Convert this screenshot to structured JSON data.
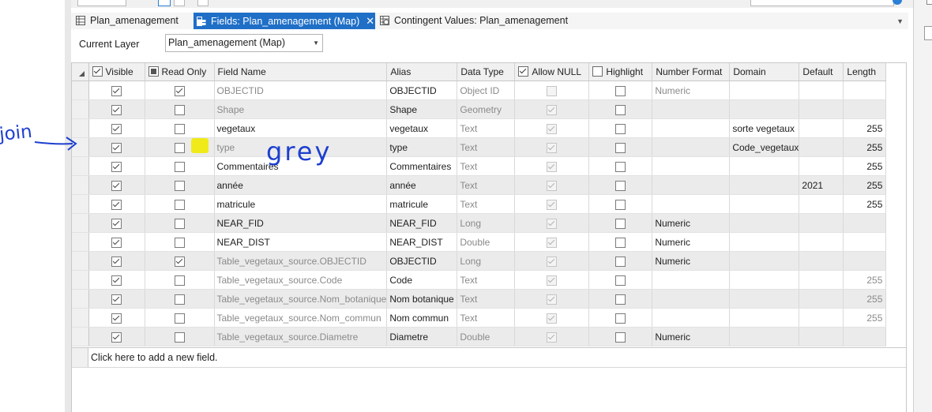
{
  "tabs": [
    {
      "label": "Plan_amenagement",
      "icon": "table-icon",
      "active": false
    },
    {
      "label": "Fields:  Plan_amenagement (Map)",
      "icon": "fields-icon",
      "active": true
    },
    {
      "label": "Contingent Values: Plan_amenagement",
      "icon": "contingent-values-icon",
      "active": false
    }
  ],
  "close_glyph": "✕",
  "current_layer": {
    "label": "Current Layer",
    "value": "Plan_amenagement (Map)"
  },
  "columns": {
    "visible": "Visible",
    "read_only": "Read Only",
    "field_name": "Field Name",
    "alias": "Alias",
    "data_type": "Data Type",
    "allow_null": "Allow NULL",
    "highlight": "Highlight",
    "number_format": "Number Format",
    "domain": "Domain",
    "default": "Default",
    "length": "Length"
  },
  "rows": [
    {
      "visible": true,
      "read_only": true,
      "field_name": "OBJECTID",
      "alias": "OBJECTID",
      "data_type": "Object ID",
      "allow_null": false,
      "null_enabled": false,
      "highlight": false,
      "number_format": "Numeric",
      "domain": "",
      "default": "",
      "length": "",
      "name_gray": true,
      "format_gray": true,
      "length_gray": false
    },
    {
      "visible": true,
      "read_only": false,
      "field_name": "Shape",
      "alias": "Shape",
      "data_type": "Geometry",
      "allow_null": true,
      "null_enabled": false,
      "highlight": false,
      "number_format": "",
      "domain": "",
      "default": "",
      "length": "",
      "name_gray": true,
      "format_gray": false,
      "length_gray": false
    },
    {
      "visible": true,
      "read_only": false,
      "field_name": "vegetaux",
      "alias": "vegetaux",
      "data_type": "Text",
      "allow_null": true,
      "null_enabled": false,
      "highlight": false,
      "number_format": "",
      "domain": "sorte vegetaux",
      "default": "",
      "length": "255",
      "name_gray": false,
      "format_gray": false,
      "length_gray": false
    },
    {
      "visible": true,
      "read_only": false,
      "field_name": "type",
      "alias": "type",
      "data_type": "Text",
      "allow_null": true,
      "null_enabled": false,
      "highlight": false,
      "number_format": "",
      "domain": "Code_vegetaux",
      "default": "",
      "length": "255",
      "name_gray": true,
      "format_gray": false,
      "length_gray": false
    },
    {
      "visible": true,
      "read_only": false,
      "field_name": "Commentaires",
      "alias": "Commentaires",
      "data_type": "Text",
      "allow_null": true,
      "null_enabled": false,
      "highlight": false,
      "number_format": "",
      "domain": "",
      "default": "",
      "length": "255",
      "name_gray": false,
      "format_gray": false,
      "length_gray": false
    },
    {
      "visible": true,
      "read_only": false,
      "field_name": "année",
      "alias": "année",
      "data_type": "Text",
      "allow_null": true,
      "null_enabled": false,
      "highlight": false,
      "number_format": "",
      "domain": "",
      "default": "2021",
      "length": "255",
      "name_gray": false,
      "format_gray": false,
      "length_gray": false
    },
    {
      "visible": true,
      "read_only": false,
      "field_name": "matricule",
      "alias": "matricule",
      "data_type": "Text",
      "allow_null": true,
      "null_enabled": false,
      "highlight": false,
      "number_format": "",
      "domain": "",
      "default": "",
      "length": "255",
      "name_gray": false,
      "format_gray": false,
      "length_gray": false
    },
    {
      "visible": true,
      "read_only": false,
      "field_name": "NEAR_FID",
      "alias": "NEAR_FID",
      "data_type": "Long",
      "allow_null": true,
      "null_enabled": false,
      "highlight": false,
      "number_format": "Numeric",
      "domain": "",
      "default": "",
      "length": "",
      "name_gray": false,
      "format_gray": false,
      "length_gray": false
    },
    {
      "visible": true,
      "read_only": false,
      "field_name": "NEAR_DIST",
      "alias": "NEAR_DIST",
      "data_type": "Double",
      "allow_null": true,
      "null_enabled": false,
      "highlight": false,
      "number_format": "Numeric",
      "domain": "",
      "default": "",
      "length": "",
      "name_gray": false,
      "format_gray": false,
      "length_gray": false
    },
    {
      "visible": true,
      "read_only": true,
      "field_name": "Table_vegetaux_source.OBJECTID",
      "alias": "OBJECTID",
      "data_type": "Long",
      "allow_null": true,
      "null_enabled": false,
      "highlight": false,
      "number_format": "Numeric",
      "domain": "",
      "default": "",
      "length": "",
      "name_gray": true,
      "format_gray": false,
      "length_gray": false
    },
    {
      "visible": true,
      "read_only": false,
      "field_name": "Table_vegetaux_source.Code",
      "alias": "Code",
      "data_type": "Text",
      "allow_null": true,
      "null_enabled": false,
      "highlight": false,
      "number_format": "",
      "domain": "",
      "default": "",
      "length": "255",
      "name_gray": true,
      "format_gray": false,
      "length_gray": true
    },
    {
      "visible": true,
      "read_only": false,
      "field_name": "Table_vegetaux_source.Nom_botanique",
      "alias": "Nom botanique",
      "data_type": "Text",
      "allow_null": true,
      "null_enabled": false,
      "highlight": false,
      "number_format": "",
      "domain": "",
      "default": "",
      "length": "255",
      "name_gray": true,
      "format_gray": false,
      "length_gray": true
    },
    {
      "visible": true,
      "read_only": false,
      "field_name": "Table_vegetaux_source.Nom_commun",
      "alias": "Nom commun",
      "data_type": "Text",
      "allow_null": true,
      "null_enabled": false,
      "highlight": false,
      "number_format": "",
      "domain": "",
      "default": "",
      "length": "255",
      "name_gray": true,
      "format_gray": false,
      "length_gray": true
    },
    {
      "visible": true,
      "read_only": false,
      "field_name": "Table_vegetaux_source.Diametre",
      "alias": "Diametre",
      "data_type": "Double",
      "allow_null": true,
      "null_enabled": false,
      "highlight": false,
      "number_format": "Numeric",
      "domain": "",
      "default": "",
      "length": "",
      "name_gray": true,
      "format_gray": false,
      "length_gray": false
    }
  ],
  "add_field_text": "Click here to add a new field.",
  "annotations": {
    "left_note": "join",
    "row_note": "grey",
    "ink_color": "#1d3fcf",
    "highlight_color": "#f1ea1a"
  },
  "colors": {
    "accent": "#1f6fc7",
    "gray_text": "#8a8a8a",
    "alt_row": "#ebebeb"
  }
}
